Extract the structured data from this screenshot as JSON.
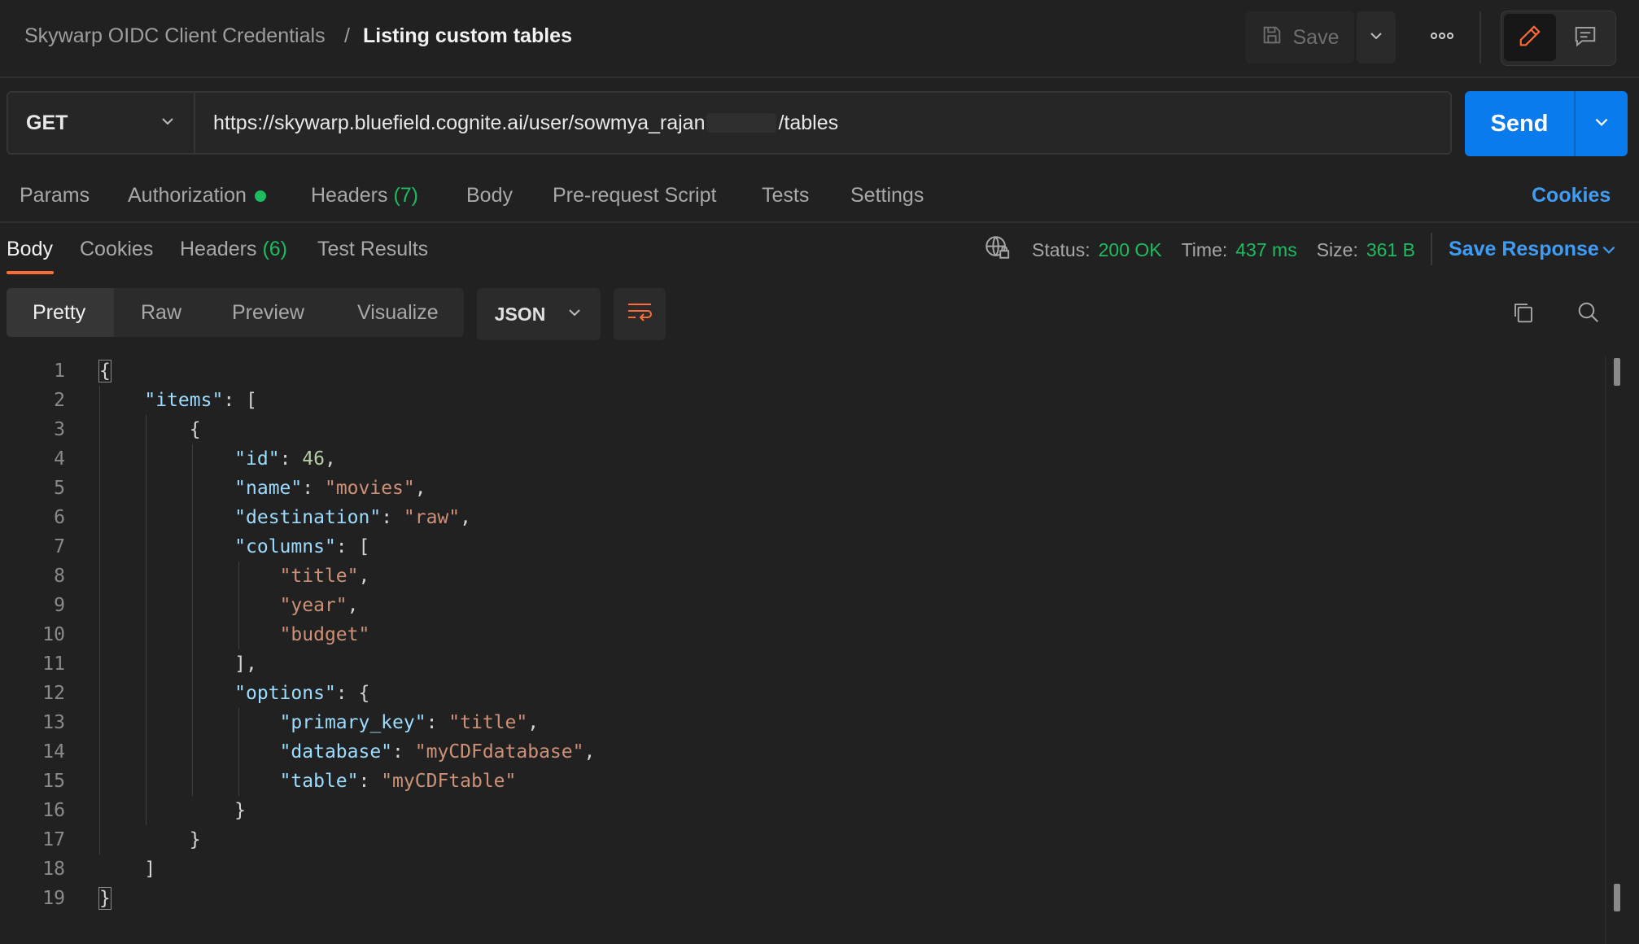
{
  "header": {
    "collection": "Skywarp OIDC Client Credentials",
    "separator": "/",
    "request_name": "Listing custom tables",
    "save_label": "Save"
  },
  "request": {
    "method": "GET",
    "url_prefix": "https://skywarp.bluefield.cognite.ai/user/sowmya_rajan",
    "url_suffix": "/tables",
    "send_label": "Send"
  },
  "request_tabs": {
    "params": "Params",
    "authorization": "Authorization",
    "headers": "Headers",
    "headers_count": "(7)",
    "body": "Body",
    "pre_request": "Pre-request Script",
    "tests": "Tests",
    "settings": "Settings",
    "cookies": "Cookies"
  },
  "response_tabs": {
    "body": "Body",
    "cookies": "Cookies",
    "headers": "Headers",
    "headers_count": "(6)",
    "test_results": "Test Results"
  },
  "status": {
    "status_label": "Status:",
    "status_value": "200 OK",
    "time_label": "Time:",
    "time_value": "437 ms",
    "size_label": "Size:",
    "size_value": "361 B",
    "save_response": "Save Response"
  },
  "view": {
    "pretty": "Pretty",
    "raw": "Raw",
    "preview": "Preview",
    "visualize": "Visualize",
    "format": "JSON"
  },
  "colors": {
    "accent_blue": "#097bed",
    "link_blue": "#3f9cf5",
    "success_green": "#1dbc61",
    "tab_orange": "#ff6c37"
  },
  "code": {
    "line_numbers": [
      "1",
      "2",
      "3",
      "4",
      "5",
      "6",
      "7",
      "8",
      "9",
      "10",
      "11",
      "12",
      "13",
      "14",
      "15",
      "16",
      "17",
      "18",
      "19"
    ],
    "items_key": "\"items\"",
    "id_key": "\"id\"",
    "id_val": "46",
    "name_key": "\"name\"",
    "name_val": "\"movies\"",
    "dest_key": "\"destination\"",
    "dest_val": "\"raw\"",
    "columns_key": "\"columns\"",
    "col1": "\"title\"",
    "col2": "\"year\"",
    "col3": "\"budget\"",
    "options_key": "\"options\"",
    "pk_key": "\"primary_key\"",
    "pk_val": "\"title\"",
    "db_key": "\"database\"",
    "db_val": "\"myCDFdatabase\"",
    "table_key": "\"table\"",
    "table_val": "\"myCDFtable\""
  }
}
